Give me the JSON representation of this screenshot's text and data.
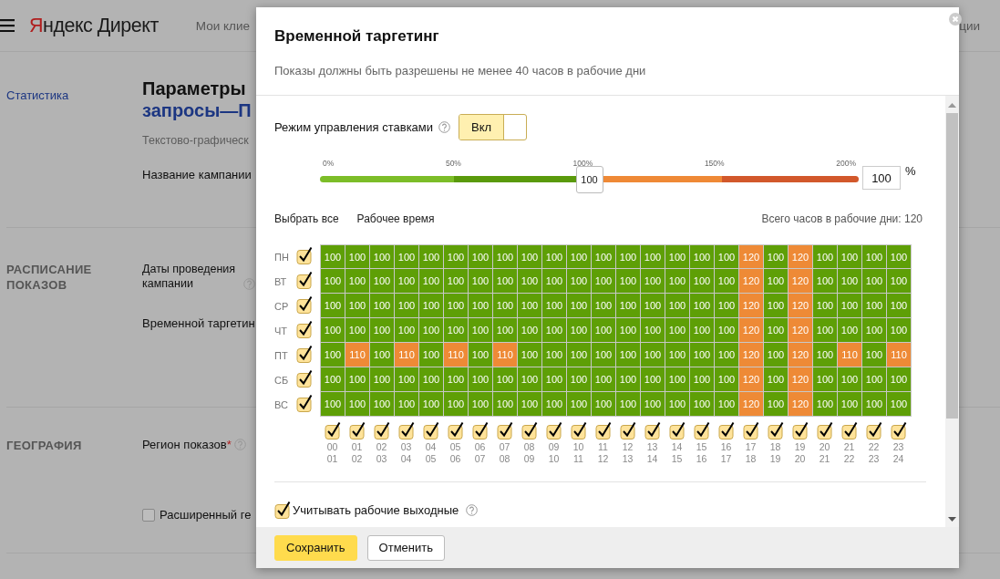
{
  "page": {
    "logo": "Яндекс Директ",
    "nav": [
      "Мои клие",
      "ции"
    ],
    "sidebar_link": "Статистика",
    "title": "Параметры",
    "title_link": "запросы—П",
    "campaign_type": "Текстово-графическ",
    "sections": [
      {
        "fields": [
          {
            "kind": "label",
            "text": "Название кампании"
          }
        ]
      },
      {
        "heading": "РАСПИСАНИЕ ПОКАЗОВ",
        "fields": [
          {
            "kind": "label",
            "text": "Даты проведения кампании",
            "help": true
          },
          {
            "kind": "label",
            "text": "Временной таргетин"
          }
        ]
      },
      {
        "heading": "ГЕОГРАФИЯ",
        "fields": [
          {
            "kind": "label",
            "text": "Регион показов",
            "help": true,
            "required_mark": "*"
          },
          {
            "kind": "checkbox",
            "text": "Расширенный ге",
            "checked": false
          }
        ]
      }
    ]
  },
  "dialog": {
    "title": "Временной таргетинг",
    "subtitle": "Показы должны быть разрешены не менее 40 часов в рабочие дни",
    "bid_mode": {
      "label": "Режим управления ставками",
      "toggle_label": "Вкл",
      "on": true
    },
    "slider": {
      "ticks": [
        "0%",
        "50%",
        "100%",
        "150%",
        "200%"
      ],
      "level": 0.5,
      "reading": "100",
      "value": "100",
      "unit": "%"
    },
    "links": [
      "Выбрать все",
      "Рабочее время"
    ],
    "total": "Всего часов в рабочие дни: 120",
    "days": [
      {
        "day": "ПН",
        "checked": true,
        "cells": [
          {
            "value": "100",
            "color": "#5e9f06"
          },
          {
            "value": "100",
            "color": "#5e9f06"
          },
          {
            "value": "100",
            "color": "#5e9f06"
          },
          {
            "value": "100",
            "color": "#5e9f06"
          },
          {
            "value": "100",
            "color": "#5e9f06"
          },
          {
            "value": "100",
            "color": "#5e9f06"
          },
          {
            "value": "100",
            "color": "#5e9f06"
          },
          {
            "value": "100",
            "color": "#5e9f06"
          },
          {
            "value": "100",
            "color": "#5e9f06"
          },
          {
            "value": "100",
            "color": "#5e9f06"
          },
          {
            "value": "100",
            "color": "#5e9f06"
          },
          {
            "value": "100",
            "color": "#5e9f06"
          },
          {
            "value": "100",
            "color": "#5e9f06"
          },
          {
            "value": "100",
            "color": "#5e9f06"
          },
          {
            "value": "100",
            "color": "#5e9f06"
          },
          {
            "value": "100",
            "color": "#5e9f06"
          },
          {
            "value": "100",
            "color": "#5e9f06"
          },
          {
            "value": "120",
            "color": "#ee8a36"
          },
          {
            "value": "100",
            "color": "#5e9f06"
          },
          {
            "value": "120",
            "color": "#ee8a36"
          },
          {
            "value": "100",
            "color": "#5e9f06"
          },
          {
            "value": "100",
            "color": "#5e9f06"
          },
          {
            "value": "100",
            "color": "#5e9f06"
          },
          {
            "value": "100",
            "color": "#5e9f06"
          }
        ]
      },
      {
        "day": "ВТ",
        "checked": true,
        "cells": [
          {
            "value": "100",
            "color": "#5e9f06"
          },
          {
            "value": "100",
            "color": "#5e9f06"
          },
          {
            "value": "100",
            "color": "#5e9f06"
          },
          {
            "value": "100",
            "color": "#5e9f06"
          },
          {
            "value": "100",
            "color": "#5e9f06"
          },
          {
            "value": "100",
            "color": "#5e9f06"
          },
          {
            "value": "100",
            "color": "#5e9f06"
          },
          {
            "value": "100",
            "color": "#5e9f06"
          },
          {
            "value": "100",
            "color": "#5e9f06"
          },
          {
            "value": "100",
            "color": "#5e9f06"
          },
          {
            "value": "100",
            "color": "#5e9f06"
          },
          {
            "value": "100",
            "color": "#5e9f06"
          },
          {
            "value": "100",
            "color": "#5e9f06"
          },
          {
            "value": "100",
            "color": "#5e9f06"
          },
          {
            "value": "100",
            "color": "#5e9f06"
          },
          {
            "value": "100",
            "color": "#5e9f06"
          },
          {
            "value": "100",
            "color": "#5e9f06"
          },
          {
            "value": "120",
            "color": "#ee8a36"
          },
          {
            "value": "100",
            "color": "#5e9f06"
          },
          {
            "value": "120",
            "color": "#ee8a36"
          },
          {
            "value": "100",
            "color": "#5e9f06"
          },
          {
            "value": "100",
            "color": "#5e9f06"
          },
          {
            "value": "100",
            "color": "#5e9f06"
          },
          {
            "value": "100",
            "color": "#5e9f06"
          }
        ]
      },
      {
        "day": "СР",
        "checked": true,
        "cells": [
          {
            "value": "100",
            "color": "#5e9f06"
          },
          {
            "value": "100",
            "color": "#5e9f06"
          },
          {
            "value": "100",
            "color": "#5e9f06"
          },
          {
            "value": "100",
            "color": "#5e9f06"
          },
          {
            "value": "100",
            "color": "#5e9f06"
          },
          {
            "value": "100",
            "color": "#5e9f06"
          },
          {
            "value": "100",
            "color": "#5e9f06"
          },
          {
            "value": "100",
            "color": "#5e9f06"
          },
          {
            "value": "100",
            "color": "#5e9f06"
          },
          {
            "value": "100",
            "color": "#5e9f06"
          },
          {
            "value": "100",
            "color": "#5e9f06"
          },
          {
            "value": "100",
            "color": "#5e9f06"
          },
          {
            "value": "100",
            "color": "#5e9f06"
          },
          {
            "value": "100",
            "color": "#5e9f06"
          },
          {
            "value": "100",
            "color": "#5e9f06"
          },
          {
            "value": "100",
            "color": "#5e9f06"
          },
          {
            "value": "100",
            "color": "#5e9f06"
          },
          {
            "value": "120",
            "color": "#ee8a36"
          },
          {
            "value": "100",
            "color": "#5e9f06"
          },
          {
            "value": "120",
            "color": "#ee8a36"
          },
          {
            "value": "100",
            "color": "#5e9f06"
          },
          {
            "value": "100",
            "color": "#5e9f06"
          },
          {
            "value": "100",
            "color": "#5e9f06"
          },
          {
            "value": "100",
            "color": "#5e9f06"
          }
        ]
      },
      {
        "day": "ЧТ",
        "checked": true,
        "cells": [
          {
            "value": "100",
            "color": "#5e9f06"
          },
          {
            "value": "100",
            "color": "#5e9f06"
          },
          {
            "value": "100",
            "color": "#5e9f06"
          },
          {
            "value": "100",
            "color": "#5e9f06"
          },
          {
            "value": "100",
            "color": "#5e9f06"
          },
          {
            "value": "100",
            "color": "#5e9f06"
          },
          {
            "value": "100",
            "color": "#5e9f06"
          },
          {
            "value": "100",
            "color": "#5e9f06"
          },
          {
            "value": "100",
            "color": "#5e9f06"
          },
          {
            "value": "100",
            "color": "#5e9f06"
          },
          {
            "value": "100",
            "color": "#5e9f06"
          },
          {
            "value": "100",
            "color": "#5e9f06"
          },
          {
            "value": "100",
            "color": "#5e9f06"
          },
          {
            "value": "100",
            "color": "#5e9f06"
          },
          {
            "value": "100",
            "color": "#5e9f06"
          },
          {
            "value": "100",
            "color": "#5e9f06"
          },
          {
            "value": "100",
            "color": "#5e9f06"
          },
          {
            "value": "120",
            "color": "#ee8a36"
          },
          {
            "value": "100",
            "color": "#5e9f06"
          },
          {
            "value": "120",
            "color": "#ee8a36"
          },
          {
            "value": "100",
            "color": "#5e9f06"
          },
          {
            "value": "100",
            "color": "#5e9f06"
          },
          {
            "value": "100",
            "color": "#5e9f06"
          },
          {
            "value": "100",
            "color": "#5e9f06"
          }
        ]
      },
      {
        "day": "ПТ",
        "checked": true,
        "cells": [
          {
            "value": "100",
            "color": "#5e9f06"
          },
          {
            "value": "110",
            "color": "#ee8a36"
          },
          {
            "value": "100",
            "color": "#5e9f06"
          },
          {
            "value": "110",
            "color": "#ee8a36"
          },
          {
            "value": "100",
            "color": "#5e9f06"
          },
          {
            "value": "110",
            "color": "#ee8a36"
          },
          {
            "value": "100",
            "color": "#5e9f06"
          },
          {
            "value": "110",
            "color": "#ee8a36"
          },
          {
            "value": "100",
            "color": "#5e9f06"
          },
          {
            "value": "100",
            "color": "#5e9f06"
          },
          {
            "value": "100",
            "color": "#5e9f06"
          },
          {
            "value": "100",
            "color": "#5e9f06"
          },
          {
            "value": "100",
            "color": "#5e9f06"
          },
          {
            "value": "100",
            "color": "#5e9f06"
          },
          {
            "value": "100",
            "color": "#5e9f06"
          },
          {
            "value": "100",
            "color": "#5e9f06"
          },
          {
            "value": "100",
            "color": "#5e9f06"
          },
          {
            "value": "120",
            "color": "#ee8a36"
          },
          {
            "value": "100",
            "color": "#5e9f06"
          },
          {
            "value": "120",
            "color": "#ee8a36"
          },
          {
            "value": "100",
            "color": "#5e9f06"
          },
          {
            "value": "110",
            "color": "#ee8a36"
          },
          {
            "value": "100",
            "color": "#5e9f06"
          },
          {
            "value": "110",
            "color": "#ee8a36"
          }
        ]
      },
      {
        "day": "СБ",
        "checked": true,
        "cells": [
          {
            "value": "100",
            "color": "#5e9f06"
          },
          {
            "value": "100",
            "color": "#5e9f06"
          },
          {
            "value": "100",
            "color": "#5e9f06"
          },
          {
            "value": "100",
            "color": "#5e9f06"
          },
          {
            "value": "100",
            "color": "#5e9f06"
          },
          {
            "value": "100",
            "color": "#5e9f06"
          },
          {
            "value": "100",
            "color": "#5e9f06"
          },
          {
            "value": "100",
            "color": "#5e9f06"
          },
          {
            "value": "100",
            "color": "#5e9f06"
          },
          {
            "value": "100",
            "color": "#5e9f06"
          },
          {
            "value": "100",
            "color": "#5e9f06"
          },
          {
            "value": "100",
            "color": "#5e9f06"
          },
          {
            "value": "100",
            "color": "#5e9f06"
          },
          {
            "value": "100",
            "color": "#5e9f06"
          },
          {
            "value": "100",
            "color": "#5e9f06"
          },
          {
            "value": "100",
            "color": "#5e9f06"
          },
          {
            "value": "100",
            "color": "#5e9f06"
          },
          {
            "value": "120",
            "color": "#ee8a36"
          },
          {
            "value": "100",
            "color": "#5e9f06"
          },
          {
            "value": "120",
            "color": "#ee8a36"
          },
          {
            "value": "100",
            "color": "#5e9f06"
          },
          {
            "value": "100",
            "color": "#5e9f06"
          },
          {
            "value": "100",
            "color": "#5e9f06"
          },
          {
            "value": "100",
            "color": "#5e9f06"
          }
        ]
      },
      {
        "day": "ВС",
        "checked": true,
        "cells": [
          {
            "value": "100",
            "color": "#5e9f06"
          },
          {
            "value": "100",
            "color": "#5e9f06"
          },
          {
            "value": "100",
            "color": "#5e9f06"
          },
          {
            "value": "100",
            "color": "#5e9f06"
          },
          {
            "value": "100",
            "color": "#5e9f06"
          },
          {
            "value": "100",
            "color": "#5e9f06"
          },
          {
            "value": "100",
            "color": "#5e9f06"
          },
          {
            "value": "100",
            "color": "#5e9f06"
          },
          {
            "value": "100",
            "color": "#5e9f06"
          },
          {
            "value": "100",
            "color": "#5e9f06"
          },
          {
            "value": "100",
            "color": "#5e9f06"
          },
          {
            "value": "100",
            "color": "#5e9f06"
          },
          {
            "value": "100",
            "color": "#5e9f06"
          },
          {
            "value": "100",
            "color": "#5e9f06"
          },
          {
            "value": "100",
            "color": "#5e9f06"
          },
          {
            "value": "100",
            "color": "#5e9f06"
          },
          {
            "value": "100",
            "color": "#5e9f06"
          },
          {
            "value": "120",
            "color": "#ee8a36"
          },
          {
            "value": "100",
            "color": "#5e9f06"
          },
          {
            "value": "120",
            "color": "#ee8a36"
          },
          {
            "value": "100",
            "color": "#5e9f06"
          },
          {
            "value": "100",
            "color": "#5e9f06"
          },
          {
            "value": "100",
            "color": "#5e9f06"
          },
          {
            "value": "100",
            "color": "#5e9f06"
          }
        ]
      }
    ],
    "hours": [
      {
        "from": "00",
        "to": "01",
        "checked": true
      },
      {
        "from": "01",
        "to": "02",
        "checked": true
      },
      {
        "from": "02",
        "to": "03",
        "checked": true
      },
      {
        "from": "03",
        "to": "04",
        "checked": true
      },
      {
        "from": "04",
        "to": "05",
        "checked": true
      },
      {
        "from": "05",
        "to": "06",
        "checked": true
      },
      {
        "from": "06",
        "to": "07",
        "checked": true
      },
      {
        "from": "07",
        "to": "08",
        "checked": true
      },
      {
        "from": "08",
        "to": "09",
        "checked": true
      },
      {
        "from": "09",
        "to": "10",
        "checked": true
      },
      {
        "from": "10",
        "to": "11",
        "checked": true
      },
      {
        "from": "11",
        "to": "12",
        "checked": true
      },
      {
        "from": "12",
        "to": "13",
        "checked": true
      },
      {
        "from": "13",
        "to": "14",
        "checked": true
      },
      {
        "from": "14",
        "to": "15",
        "checked": true
      },
      {
        "from": "15",
        "to": "16",
        "checked": true
      },
      {
        "from": "16",
        "to": "17",
        "checked": true
      },
      {
        "from": "17",
        "to": "18",
        "checked": true
      },
      {
        "from": "18",
        "to": "19",
        "checked": true
      },
      {
        "from": "19",
        "to": "20",
        "checked": true
      },
      {
        "from": "20",
        "to": "21",
        "checked": true
      },
      {
        "from": "21",
        "to": "22",
        "checked": true
      },
      {
        "from": "22",
        "to": "23",
        "checked": true
      },
      {
        "from": "23",
        "to": "24",
        "checked": true
      }
    ],
    "working_weekends": {
      "label": "Учитывать рабочие выходные",
      "checked": true
    },
    "buttons": [
      {
        "label": "Сохранить",
        "kind": "primary"
      },
      {
        "label": "Отменить",
        "kind": "secondary"
      }
    ]
  }
}
